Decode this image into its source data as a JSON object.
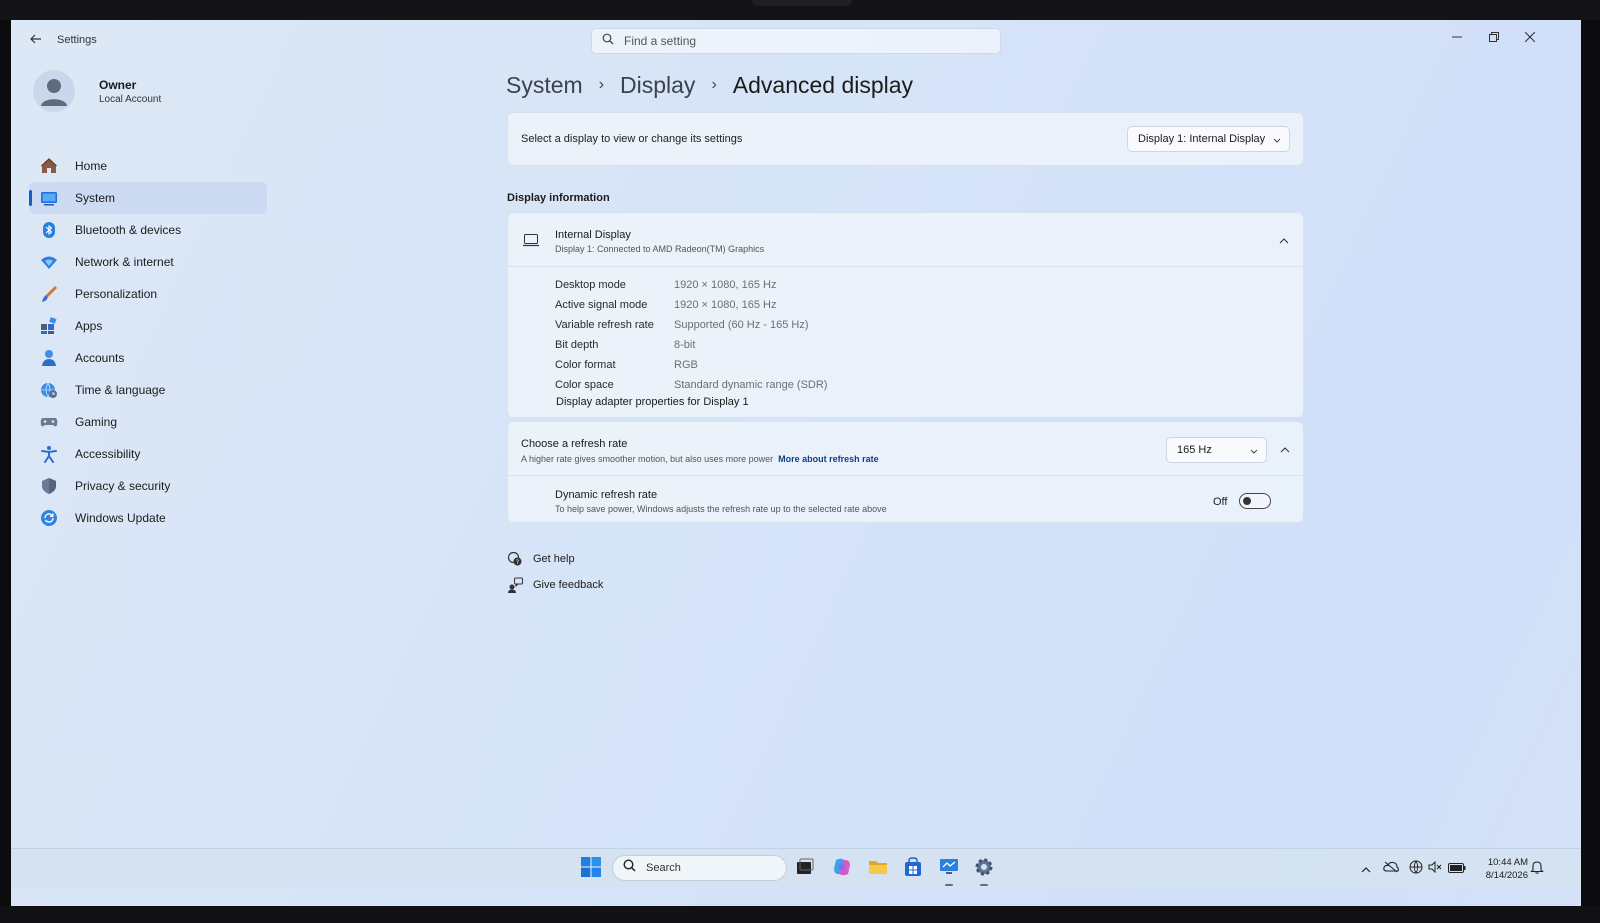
{
  "window": {
    "app_title": "Settings",
    "search_placeholder": "Find a setting"
  },
  "user": {
    "name": "Owner",
    "account_type": "Local Account"
  },
  "sidebar": {
    "items": [
      {
        "label": "Home",
        "icon": "home-icon"
      },
      {
        "label": "System",
        "icon": "system-icon",
        "active": true
      },
      {
        "label": "Bluetooth & devices",
        "icon": "bluetooth-icon"
      },
      {
        "label": "Network & internet",
        "icon": "wifi-icon"
      },
      {
        "label": "Personalization",
        "icon": "brush-icon"
      },
      {
        "label": "Apps",
        "icon": "apps-icon"
      },
      {
        "label": "Accounts",
        "icon": "person-icon"
      },
      {
        "label": "Time & language",
        "icon": "globe-clock-icon"
      },
      {
        "label": "Gaming",
        "icon": "gamepad-icon"
      },
      {
        "label": "Accessibility",
        "icon": "accessibility-icon"
      },
      {
        "label": "Privacy & security",
        "icon": "shield-icon"
      },
      {
        "label": "Windows Update",
        "icon": "update-icon"
      }
    ]
  },
  "breadcrumb": {
    "items": [
      "System",
      "Display",
      "Advanced display"
    ],
    "separator": "›"
  },
  "display_select": {
    "label": "Select a display to view or change its settings",
    "value": "Display 1: Internal Display"
  },
  "display_info": {
    "section_title": "Display information",
    "title": "Internal Display",
    "subtitle": "Display 1: Connected to AMD Radeon(TM) Graphics",
    "specs": [
      {
        "key": "Desktop mode",
        "value": "1920 × 1080, 165 Hz"
      },
      {
        "key": "Active signal mode",
        "value": "1920 × 1080, 165 Hz"
      },
      {
        "key": "Variable refresh rate",
        "value": "Supported (60 Hz - 165 Hz)"
      },
      {
        "key": "Bit depth",
        "value": "8-bit"
      },
      {
        "key": "Color format",
        "value": "RGB"
      },
      {
        "key": "Color space",
        "value": "Standard dynamic range (SDR)"
      }
    ],
    "adapter_link": "Display adapter properties for Display 1"
  },
  "refresh_rate": {
    "title": "Choose a refresh rate",
    "subtitle": "A higher rate gives smoother motion, but also uses more power",
    "link": "More about refresh rate",
    "value": "165 Hz",
    "dynamic_title": "Dynamic refresh rate",
    "dynamic_subtitle": "To help save power, Windows adjusts the refresh rate up to the selected rate above",
    "dynamic_state": "Off"
  },
  "help": {
    "get_help": "Get help",
    "give_feedback": "Give feedback"
  },
  "taskbar": {
    "search_placeholder": "Search",
    "time": "10:44 AM",
    "date": "8/14/2026"
  },
  "colors": {
    "accent": "#0f62c9",
    "link": "#0f3f8a"
  }
}
